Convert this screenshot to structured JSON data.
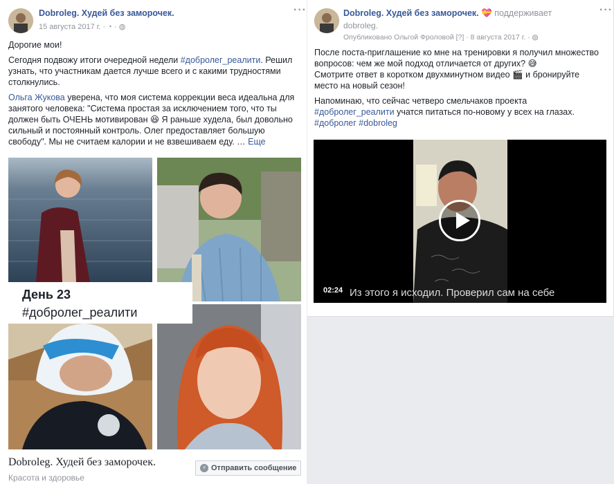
{
  "left_post": {
    "page_name": "Dobroleg. Худей без заморочек.",
    "date": "15 августа 2017 г. ·",
    "greeting": "Дорогие мои!",
    "para1_a": "Сегодня подвожу итоги очередной недели ",
    "para1_hashtag": "#добролег_реалити",
    "para1_b": ". Решил узнать, что участникам дается лучше всего и с какими трудностями столкнулись.",
    "para2_name": "Ольга Жукова",
    "para2_text": " уверена, что моя система коррекции веса идеальна для занятого человека: \"Система простая за исключением того, что ты должен быть ОЧЕНЬ мотивирован 😆 Я раньше худела, был довольно сильный и постоянный контроль. Олег предоставляет большую свободу\". Мы не считаем калории и не взвешиваем еду. … ",
    "more_link": "Еще",
    "overlay_day": "День 23",
    "overlay_tag": "#добролег_реалити",
    "footer_page_name": "Dobroleg. Худей без заморочек.",
    "footer_category": "Красота и здоровье",
    "message_button": "Отправить сообщение"
  },
  "right_post": {
    "page_name": "Dobroleg. Худей без заморочек.",
    "supports_text": "поддерживает",
    "subtitle": "dobroleg.",
    "published_by": "Опубликовано Ольгой Фроловой [?] · 8 августа 2017 г. ·",
    "para1": "После поста-приглашение ко мне на тренировки я получил множество вопросов: чем же мой подход отличается от других? 😅",
    "para2": "Смотрите ответ в коротком двухминутном видео 🎬 и бронируйте место на новый сезон!",
    "para3": "Напоминаю, что сейчас четверо смельчаков проекта",
    "para3_tag": "#добролег_реалити",
    "para3_b": " учатся питаться по-новому у всех на глазах.",
    "tags_a": "#добролег",
    "tags_b": "#dobroleg",
    "video_time": "02:24",
    "video_caption": "Из этого я исходил. Проверил сам на себе"
  },
  "icons": [
    "more-dots-icon",
    "globe-icon",
    "play-icon",
    "messenger-icon",
    "heart-badge-icon"
  ],
  "colors": {
    "link": "#365899",
    "meta": "#90949c",
    "text": "#1d2129",
    "bg": "#e9ebee"
  }
}
